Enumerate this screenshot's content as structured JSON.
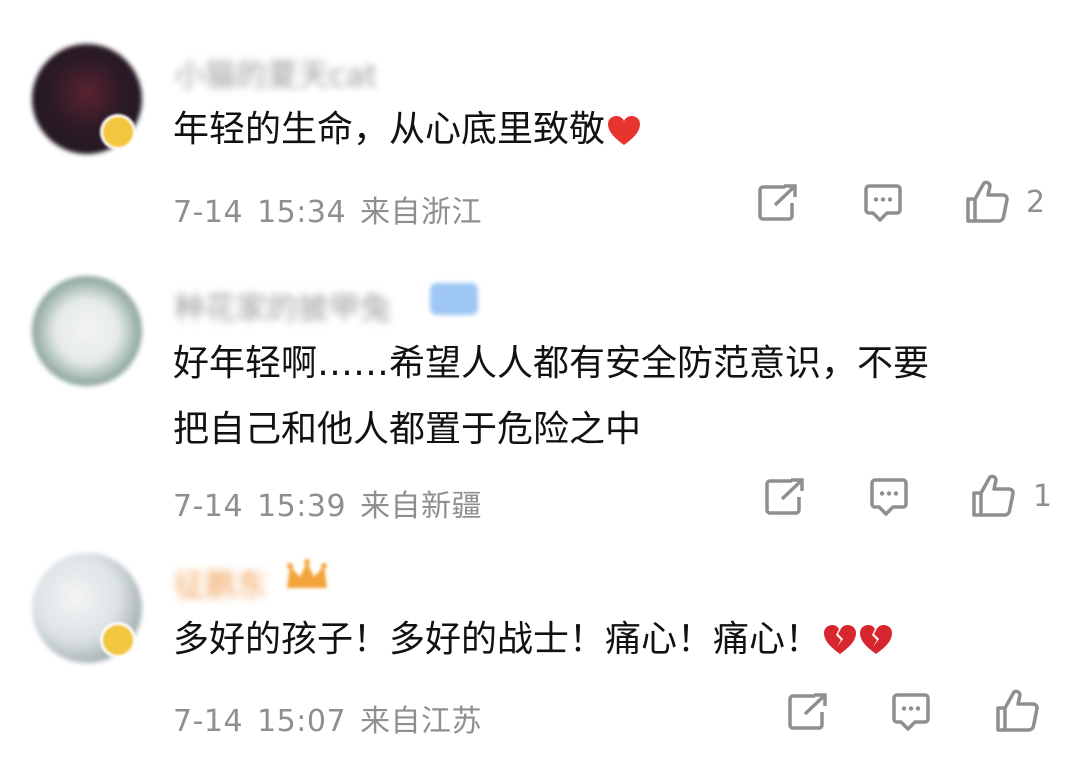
{
  "comments": [
    {
      "username": "小猫的夏天cat",
      "text_lines": [
        "年轻的生命，从心底里致敬"
      ],
      "date": "7-14",
      "time": "15:34",
      "location": "来自浙江",
      "likes": "2",
      "emoji": "red-heart",
      "username_color": "#9b9b9b"
    },
    {
      "username": "种花家的披甲兔",
      "text_lines": [
        "好年轻啊……希望人人都有安全防范意识，不要",
        "把自己和他人都置于危险之中"
      ],
      "date": "7-14",
      "time": "15:39",
      "location": "来自新疆",
      "likes": "1",
      "username_color": "#9b9b9b"
    },
    {
      "username": "征鹏东",
      "text_lines": [
        "多好的孩子！多好的战士！痛心！痛心！"
      ],
      "date": "7-14",
      "time": "15:07",
      "location": "来自江苏",
      "likes": "",
      "emoji": "broken-heart-x2",
      "username_color": "#f0a055"
    }
  ],
  "colors": {
    "meta_gray": "#8f8f8f",
    "heart_red": "#e8342f",
    "badge_yellow": "#f3c640",
    "vip_blue": "#9ec7f5"
  },
  "icons": [
    "share-icon",
    "reply-icon",
    "like-icon"
  ]
}
